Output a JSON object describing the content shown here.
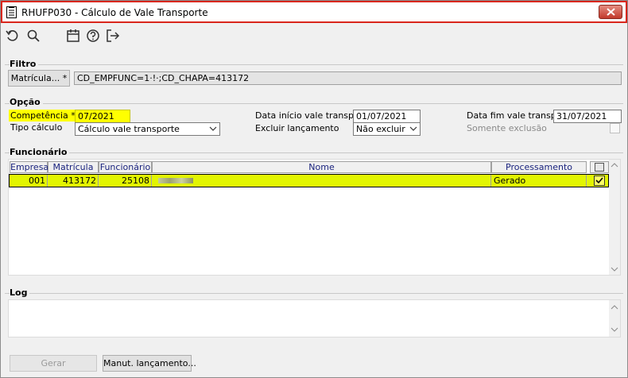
{
  "window": {
    "title": "RHUFP030 - Cálculo de Vale Transporte"
  },
  "toolbar": {
    "icons": [
      "undo-icon",
      "search-icon",
      "calendar-icon",
      "help-icon",
      "exit-icon"
    ]
  },
  "filtro": {
    "title": "Filtro",
    "button_label": "Matrícula... *",
    "value": "CD_EMPFUNC=1·!·;CD_CHAPA=413172"
  },
  "opcao": {
    "title": "Opção",
    "competencia_label": "Competência *",
    "competencia_value": "07/2021",
    "tipo_calculo_label": "Tipo cálculo",
    "tipo_calculo_value": "Cálculo vale transporte",
    "data_inicio_label": "Data início vale transp.",
    "data_inicio_value": "01/07/2021",
    "excluir_label": "Excluir lançamento",
    "excluir_value": "Não excluir",
    "data_fim_label": "Data fim vale transp.",
    "data_fim_value": "31/07/2021",
    "somente_exclusao_label": "Somente exclusão"
  },
  "funcionario": {
    "title": "Funcionário",
    "columns": [
      "Empresa",
      "Matrícula",
      "Funcionário",
      "Nome",
      "Processamento"
    ],
    "rows": [
      {
        "empresa": "001",
        "matricula": "413172",
        "funcionario": "25108",
        "nome": "",
        "processamento": "Gerado",
        "checked": true
      }
    ]
  },
  "log": {
    "title": "Log"
  },
  "footer": {
    "gerar_label": "Gerar",
    "manut_label": "Manut. lançamento..."
  },
  "colors": {
    "highlight": "#ffff00",
    "row_highlight": "#e2f500",
    "title_border": "#d9261c",
    "header_text": "#1a237e"
  }
}
